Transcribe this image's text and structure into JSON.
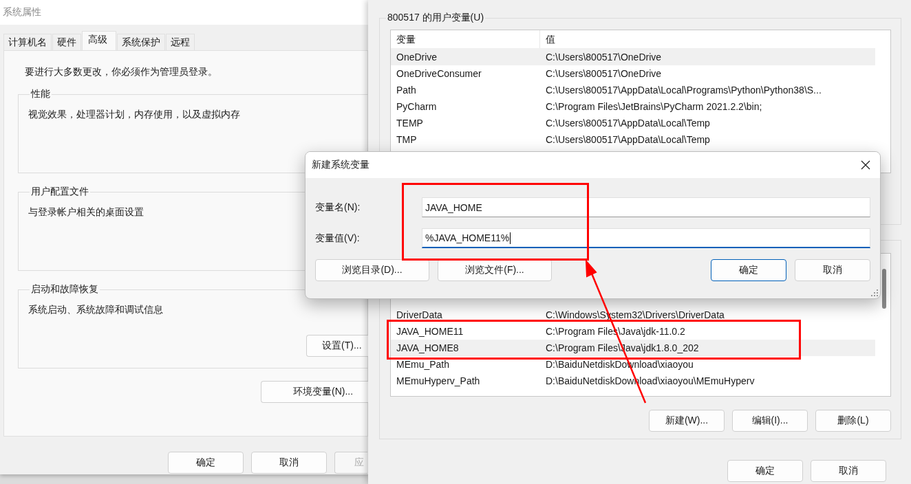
{
  "system_properties": {
    "title": "系统属性",
    "tabs": [
      {
        "label": "计算机名",
        "selected": false
      },
      {
        "label": "硬件",
        "selected": false
      },
      {
        "label": "高级",
        "selected": true
      },
      {
        "label": "系统保护",
        "selected": false
      },
      {
        "label": "远程",
        "selected": false
      }
    ],
    "notice": "要进行大多数更改，你必须作为管理员登录。",
    "groups": [
      {
        "title": "性能",
        "description": "视觉效果，处理器计划，内存使用，以及虚拟内存"
      },
      {
        "title": "用户配置文件",
        "description": "与登录帐户相关的桌面设置"
      },
      {
        "title": "启动和故障恢复",
        "description": "系统启动、系统故障和调试信息",
        "button": "设置(T)..."
      }
    ],
    "env_button": "环境变量(N)...",
    "buttons": [
      {
        "label": "确定",
        "disabled": false
      },
      {
        "label": "取消",
        "disabled": false
      },
      {
        "label": "应",
        "disabled": true
      }
    ]
  },
  "environment_variables": {
    "user_group_title": "800517 的用户变量(U)",
    "user_columns": [
      "变量",
      "值"
    ],
    "user_rows": [
      {
        "name": "OneDrive",
        "value": "C:\\Users\\800517\\OneDrive",
        "selected": true
      },
      {
        "name": "OneDriveConsumer",
        "value": "C:\\Users\\800517\\OneDrive",
        "selected": false
      },
      {
        "name": "Path",
        "value": "C:\\Users\\800517\\AppData\\Local\\Programs\\Python\\Python38\\S...",
        "selected": false
      },
      {
        "name": "PyCharm",
        "value": "C:\\Program Files\\JetBrains\\PyCharm 2021.2.2\\bin;",
        "selected": false
      },
      {
        "name": "TEMP",
        "value": "C:\\Users\\800517\\AppData\\Local\\Temp",
        "selected": false
      },
      {
        "name": "TMP",
        "value": "C:\\Users\\800517\\AppData\\Local\\Temp",
        "selected": false
      }
    ],
    "system_rows": [
      {
        "name": "DriverData",
        "value": "C:\\Windows\\System32\\Drivers\\DriverData",
        "selected": false
      },
      {
        "name": "JAVA_HOME11",
        "value": "C:\\Program Files\\Java\\jdk-11.0.2",
        "selected": false
      },
      {
        "name": "JAVA_HOME8",
        "value": "C:\\Program Files\\Java\\jdk1.8.0_202",
        "selected": true
      },
      {
        "name": "MEmu_Path",
        "value": "D:\\BaiduNetdiskDownload\\xiaoyou",
        "selected": false
      },
      {
        "name": "MEmuHyperv_Path",
        "value": "D:\\BaiduNetdiskDownload\\xiaoyou\\MEmuHyperv",
        "selected": false
      }
    ],
    "system_buttons": [
      "新建(W)...",
      "编辑(I)...",
      "删除(L)"
    ],
    "buttons": [
      "确定",
      "取消"
    ]
  },
  "new_variable_dialog": {
    "title": "新建系统变量",
    "fields": [
      {
        "label": "变量名(N):",
        "value": "JAVA_HOME",
        "focused": false
      },
      {
        "label": "变量值(V):",
        "value": "%JAVA_HOME11%",
        "focused": true
      }
    ],
    "browse_buttons": [
      "浏览目录(D)...",
      "浏览文件(F)..."
    ],
    "buttons": [
      {
        "label": "确定",
        "default": true
      },
      {
        "label": "取消",
        "default": false
      }
    ]
  }
}
